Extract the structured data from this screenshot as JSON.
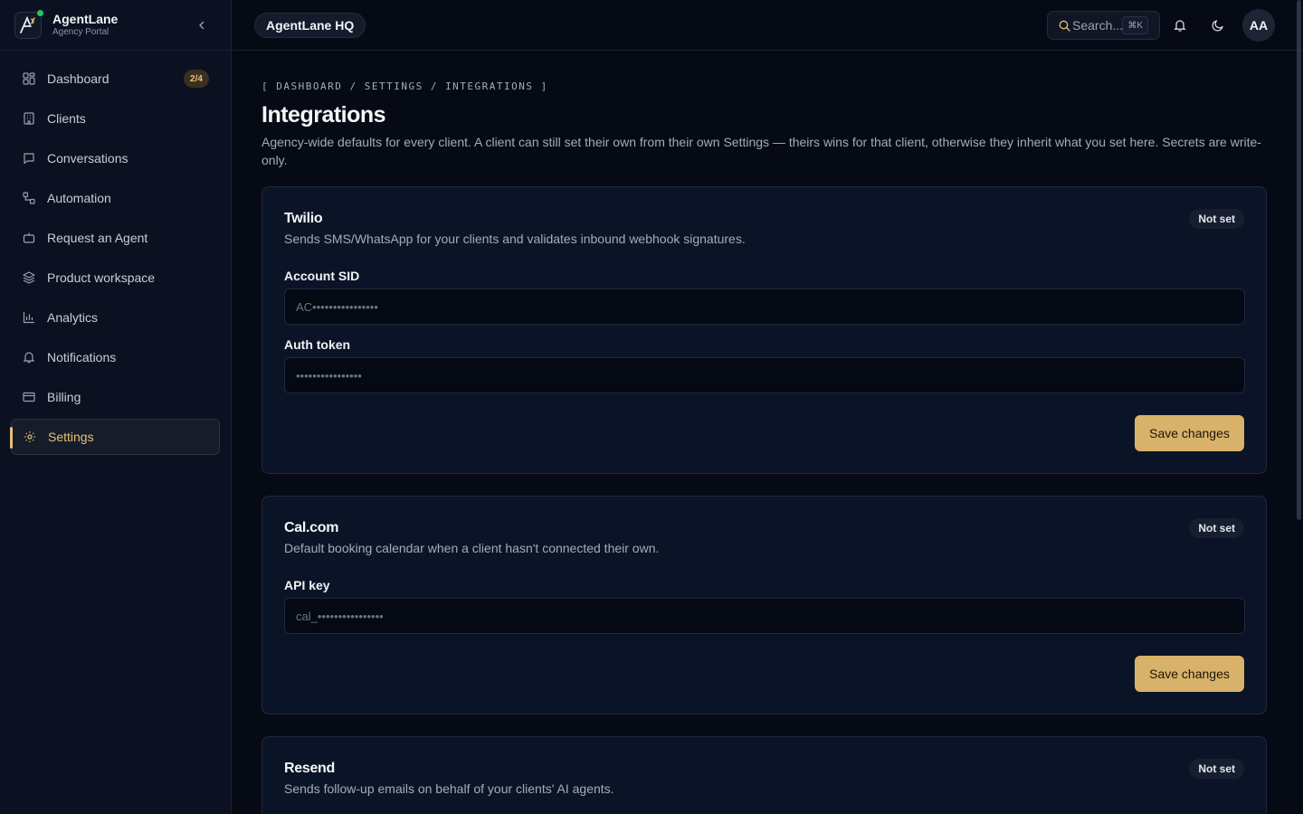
{
  "brand": {
    "name": "AgentLane",
    "subtitle": "Agency Portal"
  },
  "sidebar": {
    "items": [
      {
        "label": "Dashboard",
        "icon": "dashboard-icon",
        "badge": "2/4"
      },
      {
        "label": "Clients",
        "icon": "building-icon"
      },
      {
        "label": "Conversations",
        "icon": "message-icon"
      },
      {
        "label": "Automation",
        "icon": "workflow-icon"
      },
      {
        "label": "Request an Agent",
        "icon": "bot-icon"
      },
      {
        "label": "Product workspace",
        "icon": "layers-icon"
      },
      {
        "label": "Analytics",
        "icon": "bar-chart-icon"
      },
      {
        "label": "Notifications",
        "icon": "bell-icon"
      },
      {
        "label": "Billing",
        "icon": "credit-card-icon"
      },
      {
        "label": "Settings",
        "icon": "gear-icon",
        "active": true
      }
    ]
  },
  "topbar": {
    "workspace": "AgentLane HQ",
    "search_placeholder": "Search...",
    "search_shortcut": "⌘K",
    "avatar_initials": "AA"
  },
  "page": {
    "breadcrumb": "[ DASHBOARD / SETTINGS / INTEGRATIONS ]",
    "title": "Integrations",
    "description": "Agency-wide defaults for every client. A client can still set their own from their own Settings — theirs wins for that client, otherwise they inherit what you set here. Secrets are write-only."
  },
  "integrations": [
    {
      "name": "Twilio",
      "status": "Not set",
      "description": "Sends SMS/WhatsApp for your clients and validates inbound webhook signatures.",
      "fields": [
        {
          "label": "Account SID",
          "placeholder": "AC••••••••••••••••"
        },
        {
          "label": "Auth token",
          "placeholder": "••••••••••••••••"
        }
      ],
      "save_label": "Save changes"
    },
    {
      "name": "Cal.com",
      "status": "Not set",
      "description": "Default booking calendar when a client hasn't connected their own.",
      "fields": [
        {
          "label": "API key",
          "placeholder": "cal_••••••••••••••••"
        }
      ],
      "save_label": "Save changes"
    },
    {
      "name": "Resend",
      "status": "Not set",
      "description": "Sends follow-up emails on behalf of your clients' AI agents."
    }
  ],
  "colors": {
    "accent": "#d8b26a",
    "background": "#060a14",
    "sidebar": "#0b1120",
    "card": "#0b1426"
  }
}
